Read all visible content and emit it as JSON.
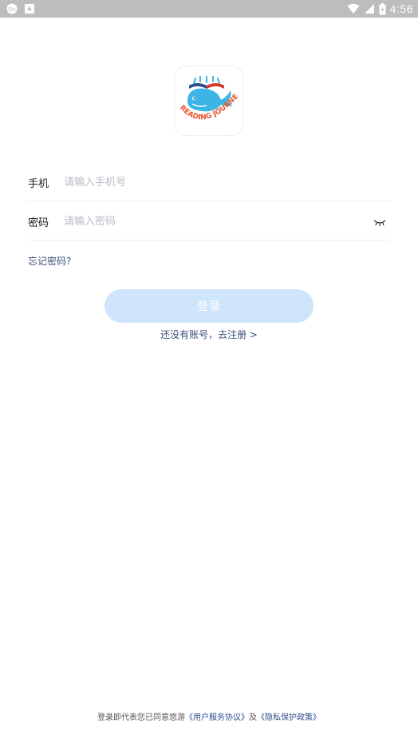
{
  "status_bar": {
    "time": "4:56",
    "left_icons": [
      "notification-badge-icon",
      "download-icon"
    ],
    "right_icons": [
      "wifi-icon",
      "cellular-signal-icon",
      "battery-icon"
    ]
  },
  "logo": {
    "text": "READING JOURNEY",
    "icon": "whale-book-logo",
    "colors": {
      "whale": "#3bb4e6",
      "text": "#e8552a",
      "book": "#d8362a"
    }
  },
  "form": {
    "phone_label": "手机",
    "phone_placeholder": "请输入手机号",
    "password_label": "密码",
    "password_placeholder": "请输入密码",
    "password_toggle_icon": "eye-closed-icon"
  },
  "forgot_password": "忘记密码?",
  "login_button": "登录",
  "register_link": "还没有账号，去注册 >",
  "footer": {
    "prefix": "登录即代表您已同意悠游",
    "terms_link": "《用户服务协议》",
    "and": "及",
    "privacy_link": "《隐私保护政策》"
  },
  "colors": {
    "status_bar": "#bdbdbd",
    "button_disabled": "#cfe5fb",
    "link": "#3a4e7a",
    "placeholder": "#b8bcc6"
  }
}
